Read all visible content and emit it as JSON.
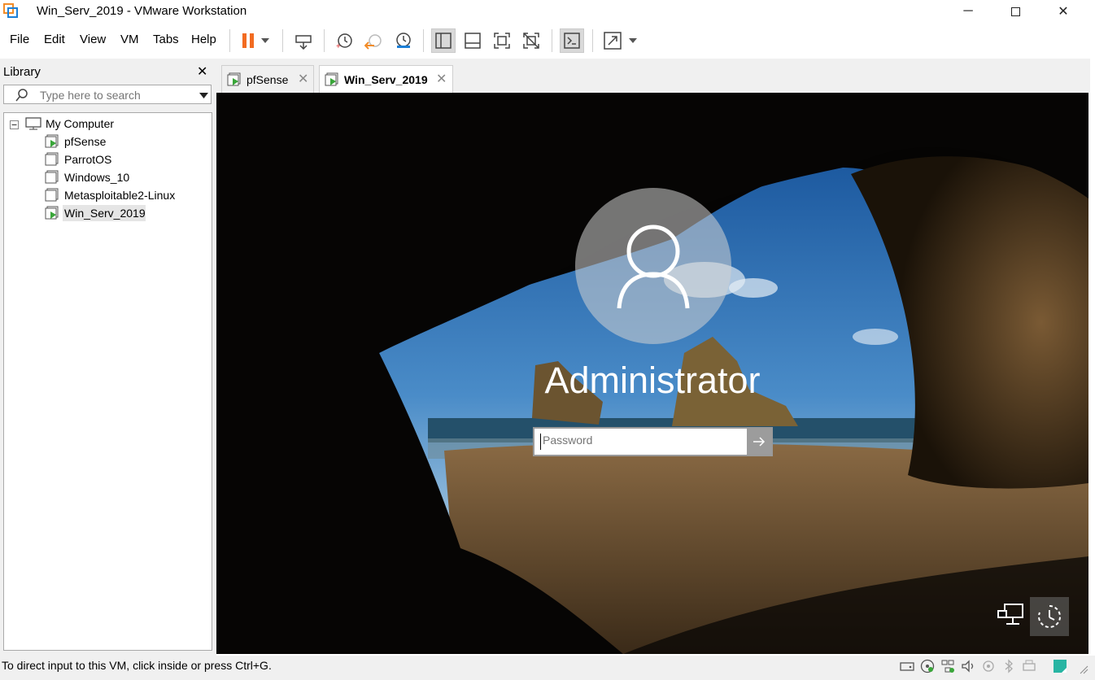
{
  "window": {
    "title": "Win_Serv_2019 - VMware Workstation"
  },
  "menu": {
    "items": [
      "File",
      "Edit",
      "View",
      "VM",
      "Tabs",
      "Help"
    ]
  },
  "library": {
    "title": "Library",
    "search_placeholder": "Type here to search",
    "root": "My Computer",
    "vms": [
      "pfSense",
      "ParrotOS",
      "Windows_10",
      "Metasploitable2-Linux",
      "Win_Serv_2019"
    ]
  },
  "tabs": [
    {
      "label": "pfSense",
      "active": false
    },
    {
      "label": "Win_Serv_2019",
      "active": true
    }
  ],
  "vm_screen": {
    "username": "Administrator",
    "password_placeholder": "Password"
  },
  "status": {
    "text": "To direct input to this VM, click inside or press Ctrl+G."
  },
  "colors": {
    "pause_accent": "#f26b21",
    "vm_running": "#3aa63a",
    "lockscreen_bg": "#050403"
  }
}
